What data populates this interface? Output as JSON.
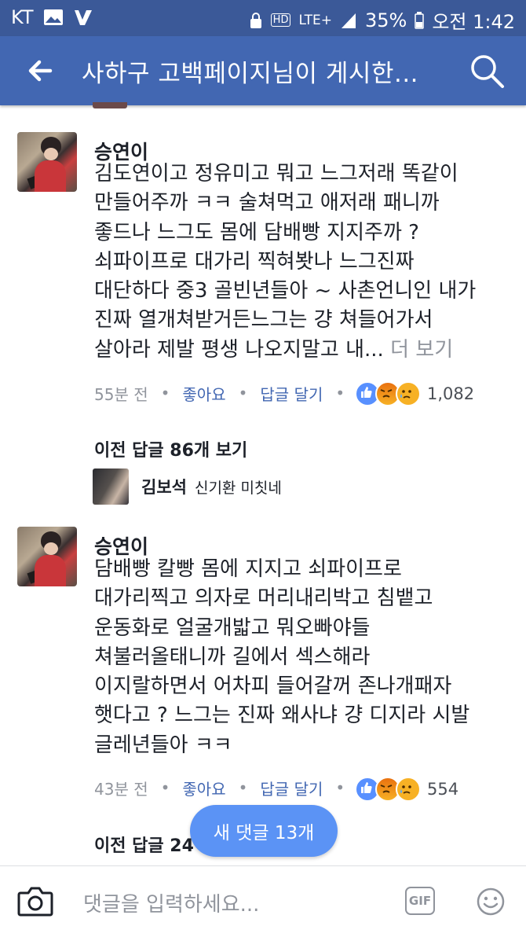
{
  "status_bar": {
    "carrier": "KT",
    "network": "LTE+",
    "hd": "HD",
    "battery": "35%",
    "time": "오전 1:42"
  },
  "app_bar": {
    "title": "사하구 고백페이지님이 게시한..."
  },
  "comments": [
    {
      "author": "승연이",
      "body": "김도연이고 정유미고 뭐고 느그저래 똑같이\n만들어주까 ㅋㅋ 술쳐먹고 애저래 패니까\n좋드나 느그도 몸에 담배빵 지지주까 ?\n쇠파이프로 대가리 찍혀봣나 느그진짜\n대단하다 중3 골빈년들아 ~ 사촌언니인 내가\n진짜 열개쳐받거든느그는 걍 쳐들어가서\n살아라 제발 평생 나오지말고 내...",
      "more": "더 보기",
      "time": "55분 전",
      "like": "좋아요",
      "reply": "답글 달기",
      "reaction_count": "1,082",
      "previous_replies": "이전 답글 86개 보기",
      "latest_reply": {
        "author": "김보석",
        "text": "신기환 미칫네"
      }
    },
    {
      "author": "승연이",
      "body": "담배빵 칼빵 몸에 지지고 쇠파이프로\n대가리찍고 의자로 머리내리박고 침뱉고\n운동화로 얼굴개밟고 뭐오빠야들\n쳐불러올태니까 길에서 섹스해라\n이지랄하면서 어차피 들어갈꺼 존나개패자\n햇다고 ? 느그는 진짜 왜사냐 걍 디지라 시발\n글레년들아 ㅋㅋ",
      "time": "43분 전",
      "like": "좋아요",
      "reply": "답글 달기",
      "reaction_count": "554",
      "previous_replies": "이전 답글 24"
    }
  ],
  "new_comments_pill": "새 댓글 13개",
  "composer": {
    "placeholder": "댓글을 입력하세요...",
    "gif": "GIF"
  },
  "colors": {
    "status_bar": "#3b5998",
    "app_bar": "#4267b2",
    "link_blue": "#4267b2",
    "meta_gray": "#90949c",
    "pill": "#5b93f5"
  },
  "icons": [
    "back-arrow-icon",
    "search-icon",
    "camera-icon",
    "gif-icon",
    "smiley-icon",
    "like-reaction-icon",
    "angry-reaction-icon",
    "sad-reaction-icon"
  ]
}
